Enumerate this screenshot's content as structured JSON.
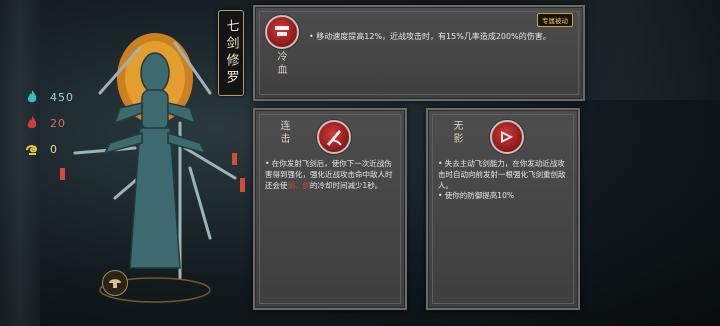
{
  "character": {
    "name": "七剑修罗"
  },
  "resources": [
    {
      "icon": "soul-flame-icon",
      "value": "450",
      "color": "#36b9c8"
    },
    {
      "icon": "blood-flame-icon",
      "value": "20",
      "color": "#d43b3b"
    },
    {
      "icon": "gold-coil-icon",
      "value": "0",
      "color": "#e6c84a"
    }
  ],
  "exclusive_skill": {
    "name": "冷血",
    "tag": "专属被动",
    "description": "• 移动速度提高12%，近战攻击时，有15%几率造成200%的伤害。"
  },
  "skill_left": {
    "name": "连击",
    "description_before": "• 在你发射飞剑后，使你下一次近战伤害得到强化，强化近战攻击命中敌人时还会使",
    "highlight": "剑、剑",
    "description_after": "的冷却时间减少1秒。"
  },
  "skill_right": {
    "name": "无影",
    "desc_1": "• 失去主动飞剑能力，在你发动近战攻击时自动向前发射一根强化飞剑重创敌人。",
    "desc_2": "• 使你的防御提高10%"
  },
  "colors": {
    "accent_gold": "#c6a04e",
    "emblem_red": "#b82525",
    "panel_gray": "#474747"
  }
}
